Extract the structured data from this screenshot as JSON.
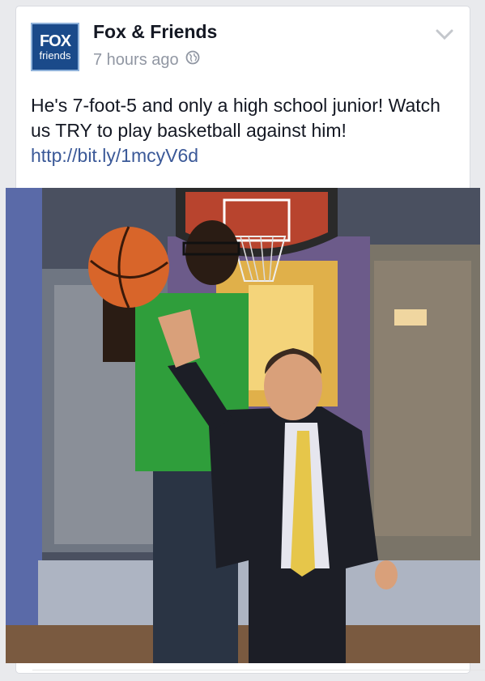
{
  "post": {
    "author": "Fox & Friends",
    "time": "7 hours ago",
    "visibility_icon": "globe-icon",
    "menu_icon": "chevron-down-icon",
    "text": "He's 7-foot-5 and only a high school junior! Watch us TRY to play basketball against him! ",
    "link": "http://bit.ly/1mcyV6d"
  },
  "avatar": {
    "line1": "FOX",
    "line2": "friends"
  },
  "colors": {
    "link": "#3b5998",
    "meta": "#9197a3",
    "avatar_bg": "#1a4a8a"
  }
}
